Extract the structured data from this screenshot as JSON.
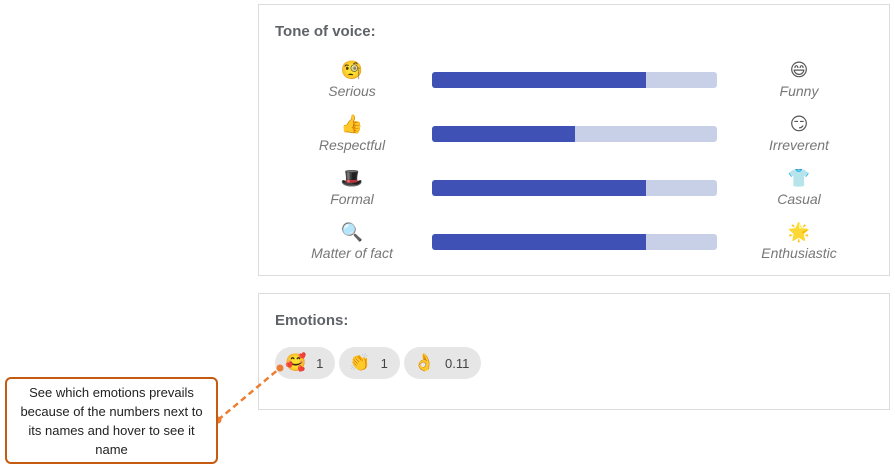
{
  "tone_of_voice": {
    "title": "Tone of voice:",
    "rows": [
      {
        "left_label": "Serious",
        "left_icon": "🧐",
        "left_icon_name": "monocle-face-icon",
        "right_label": "Funny",
        "right_icon": "😄",
        "right_icon_name": "grinning-face-icon",
        "value": 0.75
      },
      {
        "left_label": "Respectful",
        "left_icon": "👍",
        "left_icon_name": "thumbs-up-icon",
        "right_label": "Irreverent",
        "right_icon": "😏",
        "right_icon_name": "smirking-face-icon",
        "value": 0.5
      },
      {
        "left_label": "Formal",
        "left_icon": "🎩",
        "left_icon_name": "top-hat-icon",
        "right_label": "Casual",
        "right_icon": "👕",
        "right_icon_name": "t-shirt-icon",
        "value": 0.75
      },
      {
        "left_label": "Matter of fact",
        "left_icon": "🔍",
        "left_icon_name": "magnifier-icon",
        "right_label": "Enthusiastic",
        "right_icon": "🌟",
        "right_icon_name": "star-icon",
        "value": 0.75
      }
    ]
  },
  "emotions": {
    "title": "Emotions:",
    "chips": [
      {
        "emoji": "🥰",
        "icon_name": "smiling-face-with-hearts-icon",
        "count": "1"
      },
      {
        "emoji": "👏",
        "icon_name": "clapping-hands-icon",
        "count": "1"
      },
      {
        "emoji": "👌",
        "icon_name": "ok-hand-icon",
        "count": "0.11"
      }
    ]
  },
  "callout": {
    "text": "See which emotions prevails because of the numbers next to its names and hover to see it name"
  },
  "colors": {
    "bar_fill": "#3f51b5",
    "bar_track": "#c8d0e8",
    "callout_border": "#c55a11"
  }
}
